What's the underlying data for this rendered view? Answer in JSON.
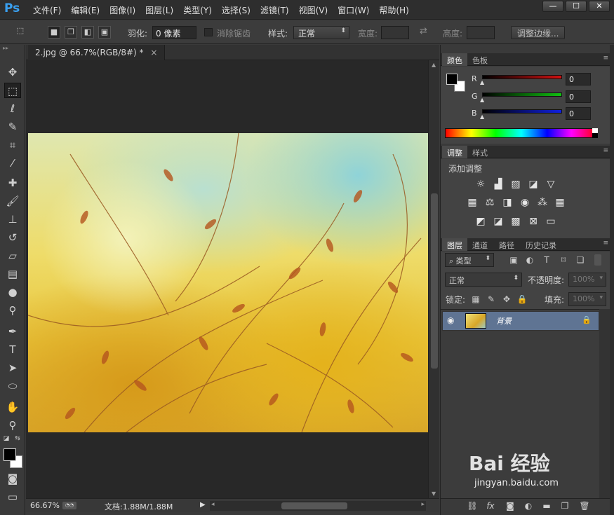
{
  "app": {
    "logo": "Ps",
    "menus": [
      "文件(F)",
      "编辑(E)",
      "图像(I)",
      "图层(L)",
      "类型(Y)",
      "选择(S)",
      "滤镜(T)",
      "视图(V)",
      "窗口(W)",
      "帮助(H)"
    ],
    "window_controls": {
      "minimize": "—",
      "maximize": "☐",
      "close": "✕"
    }
  },
  "options": {
    "feather_label": "羽化:",
    "feather_value": "0 像素",
    "antialias_label": "消除锯齿",
    "style_label": "样式:",
    "style_value": "正常",
    "width_label": "宽度:",
    "height_label": "高度:",
    "refine_button": "调整边缘..."
  },
  "document": {
    "tab_title": "2.jpg @ 66.7%(RGB/8#) *",
    "tab_close": "×",
    "zoom": "66.67%",
    "doc_info": "文档:1.88M/1.88M"
  },
  "panels": {
    "color": {
      "tabs": [
        "颜色",
        "色板"
      ],
      "channels": [
        {
          "label": "R",
          "value": "0",
          "color": "#d01010"
        },
        {
          "label": "G",
          "value": "0",
          "color": "#10c010"
        },
        {
          "label": "B",
          "value": "0",
          "color": "#1020e0"
        }
      ]
    },
    "adjustments": {
      "tabs": [
        "调整",
        "样式"
      ],
      "title": "添加调整"
    },
    "layers": {
      "tabs": [
        "图层",
        "通道",
        "路径",
        "历史记录"
      ],
      "filter_label": "类型",
      "blend_mode": "正常",
      "opacity_label": "不透明度:",
      "opacity_value": "100%",
      "lock_label": "锁定:",
      "fill_label": "填充:",
      "fill_value": "100%",
      "layer_name": "背景"
    }
  },
  "watermark": {
    "brand": "Bai 经验",
    "url": "jingyan.baidu.com"
  },
  "colors": {
    "accent": "#3aa0f0",
    "selected_layer": "#5f7493"
  }
}
